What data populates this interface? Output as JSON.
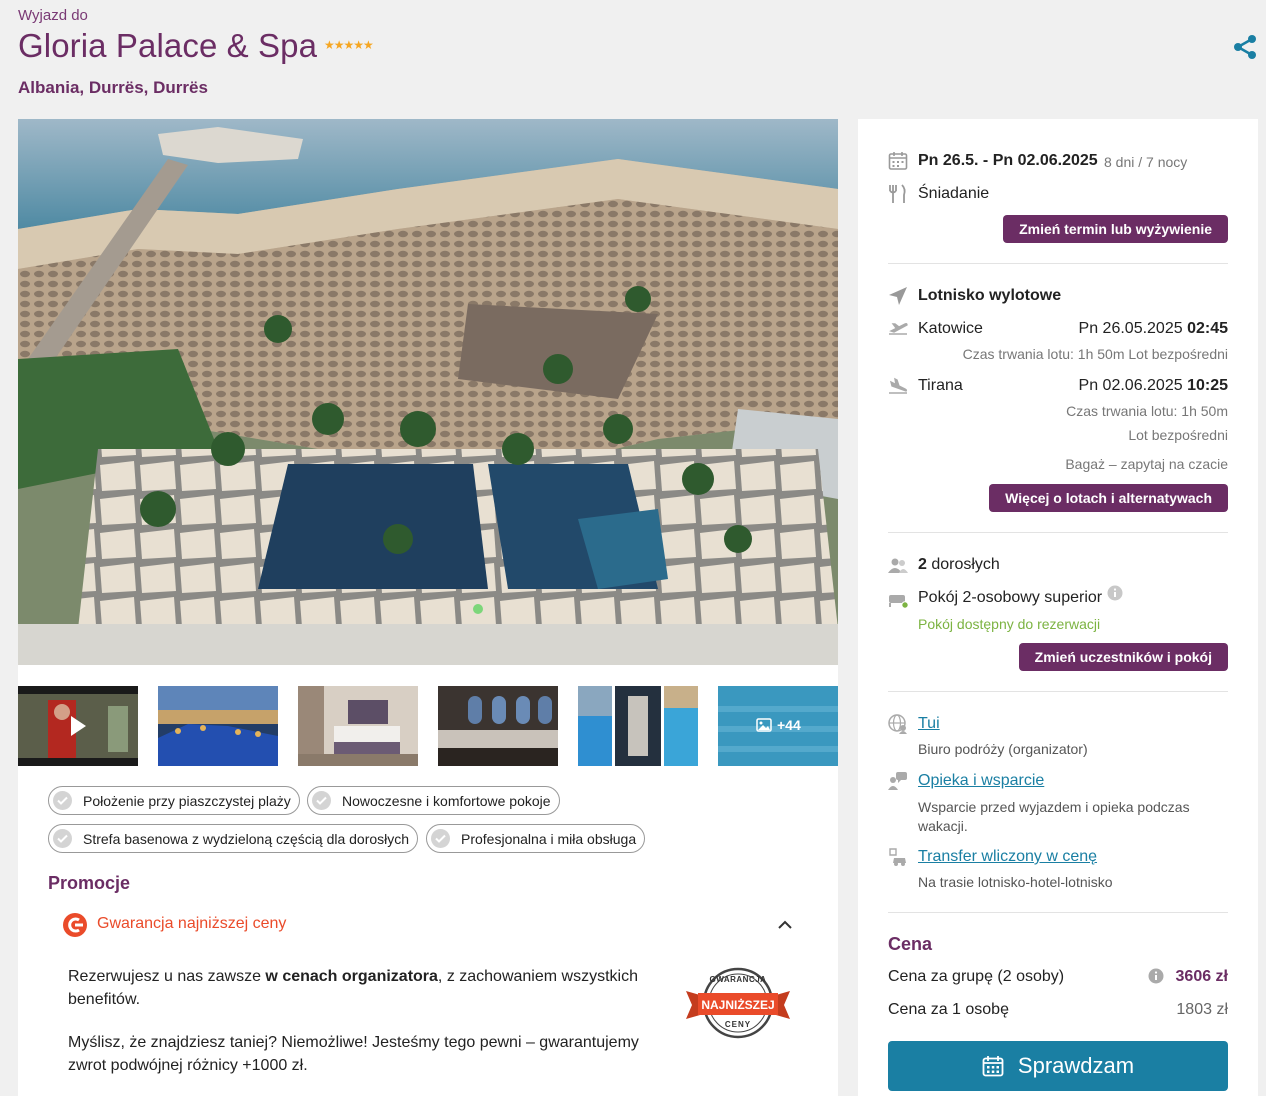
{
  "header": {
    "pretitle": "Wyjazd do",
    "hotel_name": "Gloria Palace & Spa",
    "stars": "★★★★★",
    "location": "Albania, Durrës, Durrës"
  },
  "gallery": {
    "more_count": "+44"
  },
  "features": [
    "Położenie przy piaszczystej plaży",
    "Nowoczesne i komfortowe pokoje",
    "Strefa basenowa z wydzieloną częścią dla dorosłych",
    "Profesjonalna i miła obsługa"
  ],
  "promo": {
    "heading": "Promocje",
    "guarantee_label": "Gwarancja najniższej ceny",
    "p1_a": "Rezerwujesz u nas zawsze ",
    "p1_b": "w cenach organizatora",
    "p1_c": ", z zachowaniem wszystkich benefitów.",
    "p2": "Myślisz, że znajdziesz taniej? Niemożliwe! Jesteśmy tego pewni – gwarantujemy zwrot podwójnej różnicy +1000 zł.",
    "badge_top": "GWARANCJA",
    "badge_mid": "NAJNIŻSZEJ",
    "badge_bot": "CENY"
  },
  "trip": {
    "dates": "Pn 26.5. - Pn 02.06.2025",
    "duration": "8 dni / 7 nocy",
    "board": "Śniadanie",
    "change_btn": "Zmień termin lub wyżywienie"
  },
  "flights": {
    "heading": "Lotnisko wylotowe",
    "out_city": "Katowice",
    "out_date": "Pn 26.05.2025",
    "out_time": "02:45",
    "out_info": "Czas trwania lotu: 1h 50m  Lot bezpośredni",
    "ret_city": "Tirana",
    "ret_date": "Pn 02.06.2025",
    "ret_time": "10:25",
    "ret_duration": "Czas trwania lotu: 1h 50m",
    "ret_direct": "Lot bezpośredni",
    "baggage": "Bagaż – zapytaj na czacie",
    "more_btn": "Więcej o lotach i alternatywach"
  },
  "room": {
    "adults_num": "2",
    "adults_label": " dorosłych",
    "room_type": "Pokój 2-osobowy superior",
    "availability": "Pokój dostępny do rezerwacji",
    "change_btn": "Zmień uczestników i pokój"
  },
  "organizer": {
    "name": "Tui",
    "desc": "Biuro podróży (organizator)",
    "care_link": "Opieka i wsparcie",
    "care_desc": "Wsparcie przed wyjazdem i opieka podczas wakacji.",
    "transfer_link": "Transfer wliczony w cenę",
    "transfer_desc": "Na trasie lotnisko-hotel-lotnisko"
  },
  "price": {
    "heading": "Cena",
    "group_label": "Cena za grupę (2 osoby)",
    "group_value": "3606 zł",
    "person_label": "Cena za 1 osobę",
    "person_value": "1803 zł",
    "cta": "Sprawdzam"
  },
  "colors": {
    "brand": "#6b2d64",
    "accent": "#1a7fa3",
    "available": "#7cb342",
    "promo": "#ea4b2a"
  }
}
